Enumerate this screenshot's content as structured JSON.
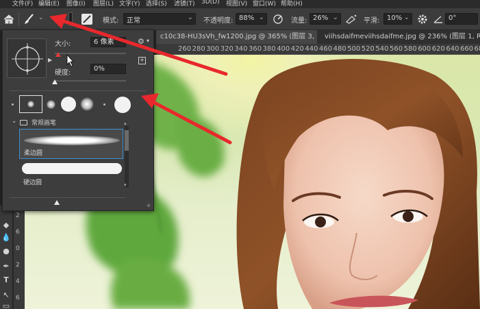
{
  "menu": [
    "文件(F)",
    "编辑(E)",
    "图像(I)",
    "图层(L)",
    "文字(Y)",
    "选择(S)",
    "滤镜(T)",
    "3D(D)",
    "视图(V)",
    "窗口(W)",
    "帮助(H)"
  ],
  "options": {
    "mode_label": "模式:",
    "mode_value": "正常",
    "opacity_label": "不透明度:",
    "opacity_value": "88%",
    "flow_label": "流量:",
    "flow_value": "26%",
    "smooth_label": "平滑:",
    "smooth_value": "10%",
    "angle_value": "0°"
  },
  "tabs": [
    "c10c38-HU3sVh_fw1200.jpg @ 365% (图层 3, RGB/8#) *",
    "viihsdaifmeviihsdaifme.jpg @ 236% (图层 1, RGB/8"
  ],
  "ruler_ticks": [
    "260",
    "280",
    "300",
    "320",
    "340",
    "360",
    "380",
    "400",
    "420",
    "440",
    "460",
    "480",
    "500",
    "520",
    "540",
    "560",
    "580",
    "600",
    "620",
    "640",
    "660",
    "680",
    "700"
  ],
  "vruler_ticks": [
    "2",
    "6",
    "0",
    "2",
    "4",
    "6"
  ],
  "brush_panel": {
    "size_label": "大小:",
    "size_value": "6 像素",
    "hardness_label": "硬度:",
    "hardness_value": "0%",
    "size_level": 0.05,
    "hardness_level": 0.0,
    "folder_label": "常规画笔",
    "brushes": [
      "柔边圆",
      "硬边圆"
    ]
  }
}
